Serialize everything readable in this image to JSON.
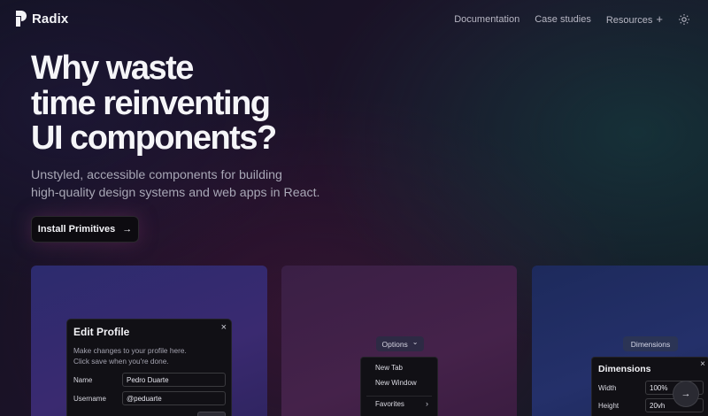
{
  "nav": {
    "brand": "Radix",
    "links": [
      "Documentation",
      "Case studies",
      "Resources"
    ],
    "resources_suffix": "+"
  },
  "hero": {
    "headline_lines": [
      "Why waste",
      "time reinventing",
      "UI components?"
    ],
    "subtitle_lines": [
      "Unstyled, accessible components for building",
      "high-quality design systems and web apps in React."
    ],
    "cta_label": "Install Primitives",
    "cta_arrow": "→"
  },
  "demo_dialog": {
    "title": "Edit Profile",
    "close": "×",
    "description_lines": [
      "Make changes to your profile here.",
      "Click save when you're done."
    ],
    "fields": [
      {
        "label": "Name",
        "value": "Pedro Duarte"
      },
      {
        "label": "Username",
        "value": "@peduarte"
      }
    ]
  },
  "demo_menu": {
    "trigger_label": "Options",
    "trigger_chevron": "⌄",
    "items": [
      "New Tab",
      "New Window",
      "Favorites"
    ],
    "submenu_chevron": "›"
  },
  "demo_popover": {
    "trigger_label": "Dimensions",
    "title": "Dimensions",
    "close": "×",
    "fields": [
      {
        "label": "Width",
        "value": "100%"
      },
      {
        "label": "Height",
        "value": "20vh"
      }
    ]
  },
  "fab": {
    "arrow": "→"
  },
  "colors": {
    "background": "#17131f",
    "card_blue": "#2c2b6e",
    "card_plum": "#3a1f45",
    "card_navy": "#1d2a5c",
    "surface": "#111015"
  }
}
